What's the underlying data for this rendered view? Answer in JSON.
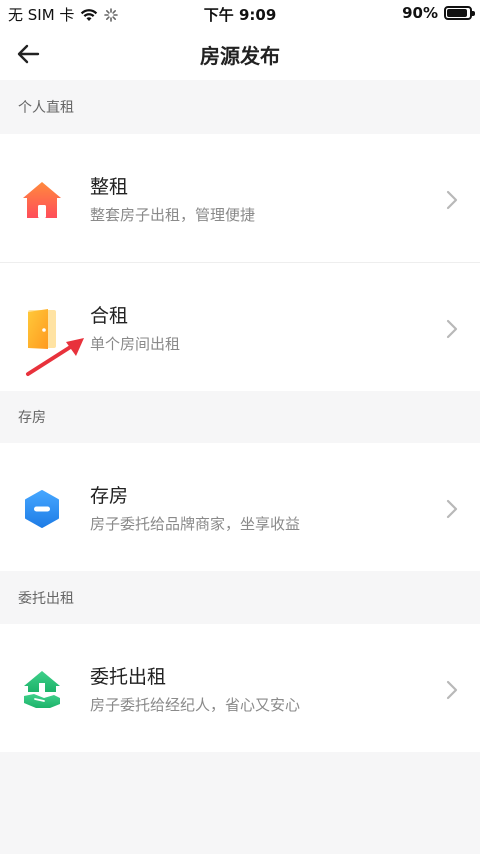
{
  "status_bar": {
    "carrier": "无 SIM 卡",
    "time": "下午 9:09",
    "battery": "90%",
    "battery_level": 0.9
  },
  "nav": {
    "title": "房源发布",
    "back_icon": "back-arrow-icon"
  },
  "sections": [
    {
      "header": "个人直租",
      "items": [
        {
          "title": "整租",
          "subtitle": "整套房子出租，管理便捷",
          "icon": "house-icon",
          "color": "#ff6a3d"
        },
        {
          "title": "合租",
          "subtitle": "单个房间出租",
          "icon": "door-icon",
          "color": "#ffb020"
        }
      ]
    },
    {
      "header": "存房",
      "items": [
        {
          "title": "存房",
          "subtitle": "房子委托给品牌商家，坐享收益",
          "icon": "hexagon-minus-icon",
          "color": "#2f8ff0"
        }
      ]
    },
    {
      "header": "委托出租",
      "items": [
        {
          "title": "委托出租",
          "subtitle": "房子委托给经纪人，省心又安心",
          "icon": "house-handshake-icon",
          "color": "#27c27a"
        }
      ]
    }
  ],
  "chevron_icon": "chevron-right-icon",
  "annotation_arrow_color": "#e8323c"
}
